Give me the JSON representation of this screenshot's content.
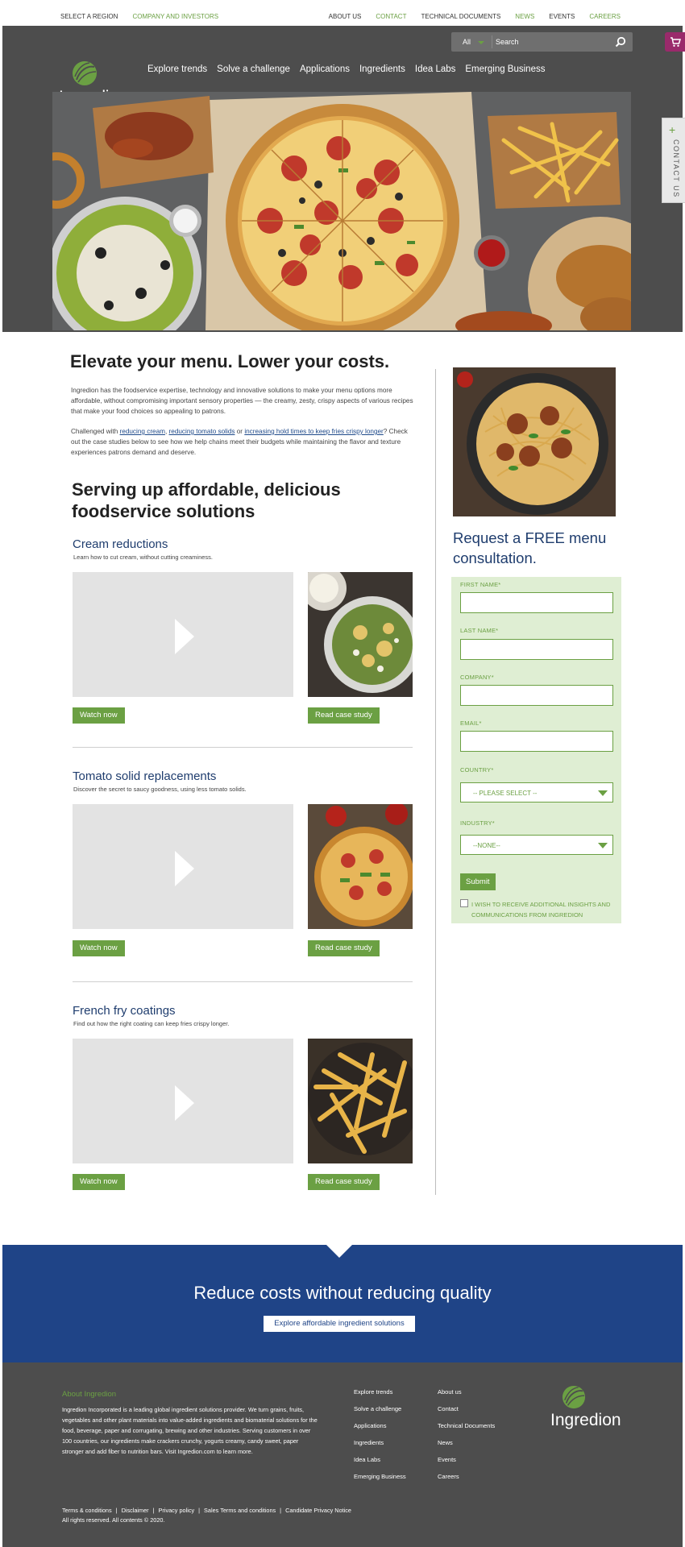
{
  "utility": {
    "left": [
      "SELECT A REGION",
      "COMPANY AND INVESTORS"
    ],
    "right": [
      "ABOUT US",
      "CONTACT",
      "TECHNICAL DOCUMENTS",
      "NEWS",
      "EVENTS",
      "CAREERS"
    ]
  },
  "header": {
    "logo_text": "Ingredion",
    "search": {
      "scope": "All",
      "placeholder": "Search"
    },
    "nav": [
      "Explore trends",
      "Solve a challenge",
      "Applications",
      "Ingredients",
      "Idea Labs",
      "Emerging Business"
    ],
    "contact_tab": "CONTACT US"
  },
  "main": {
    "title": "Elevate your menu. Lower your costs.",
    "intro_1": "Ingredion has the foodservice expertise, technology and innovative solutions to make your menu options more affordable, without compromising important sensory properties — the creamy, zesty, crispy aspects of various recipes that make your food choices so appealing to patrons.",
    "intro_2_prefix": "Challenged with ",
    "link_cream": "reducing cream",
    "comma": ", ",
    "link_tomato": "reducing tomato solids",
    "or": " or ",
    "link_fries": "increasing hold times to keep fries crispy longer",
    "intro_2_suffix": "? Check out the case studies below to see how we help chains meet their budgets while maintaining the flavor and texture experiences patrons demand and deserve.",
    "subtitle": "Serving up affordable, delicious foodservice solutions",
    "sections": [
      {
        "title": "Cream reductions",
        "desc": "Learn how to cut cream, without cutting creaminess.",
        "watch": "Watch now",
        "read": "Read case study"
      },
      {
        "title": "Tomato solid replacements",
        "desc": "Discover the secret to saucy goodness, using less tomato solids.",
        "watch": "Watch now",
        "read": "Read case study"
      },
      {
        "title": "French fry coatings",
        "desc": "Find out how the right coating can keep fries crispy longer.",
        "watch": "Watch now",
        "read": "Read case study"
      }
    ]
  },
  "form": {
    "title": "Request a FREE menu consultation.",
    "first_name": "FIRST NAME*",
    "last_name": "LAST NAME*",
    "company": "COMPANY*",
    "email": "EMAIL*",
    "country": "COUNTRY*",
    "country_value": "-- PLEASE SELECT --",
    "industry": "INDUSTRY*",
    "industry_value": "--NONE--",
    "submit": "Submit",
    "optin": "I WISH TO RECEIVE ADDITIONAL INSIGHTS AND COMMUNICATIONS FROM INGREDION"
  },
  "band": {
    "headline": "Reduce costs without reducing quality",
    "cta": "Explore affordable ingredient solutions"
  },
  "footer": {
    "about_title": "About Ingredion",
    "about_text": "Ingredion Incorporated is a leading global ingredient solutions provider. We turn grains, fruits, vegetables and other plant materials into value-added ingredients and biomaterial solutions for the food, beverage, paper and corrugating, brewing and other industries. Serving customers in over 100 countries, our ingredients make crackers crunchy, yogurts creamy, candy sweet, paper stronger and add fiber to nutrition bars. Visit Ingredion.com to learn more.",
    "col1": [
      "Explore trends",
      "Solve a challenge",
      "Applications",
      "Ingredients",
      "Idea Labs",
      "Emerging Business"
    ],
    "col2": [
      "About us",
      "Contact",
      "Technical Documents",
      "News",
      "Events",
      "Careers"
    ],
    "logo_text": "Ingredion",
    "legal_links": [
      "Terms & conditions",
      "Disclaimer",
      "Privacy policy",
      "Sales Terms and conditions",
      "Candidate Privacy Notice"
    ],
    "copyright": "All rights reserved. All contents © 2020."
  },
  "colors": {
    "brand_green": "#6ba043",
    "brand_blue": "#1f4487",
    "header_gray": "#4d4d4d",
    "cart_purple": "#9a2a6b"
  }
}
